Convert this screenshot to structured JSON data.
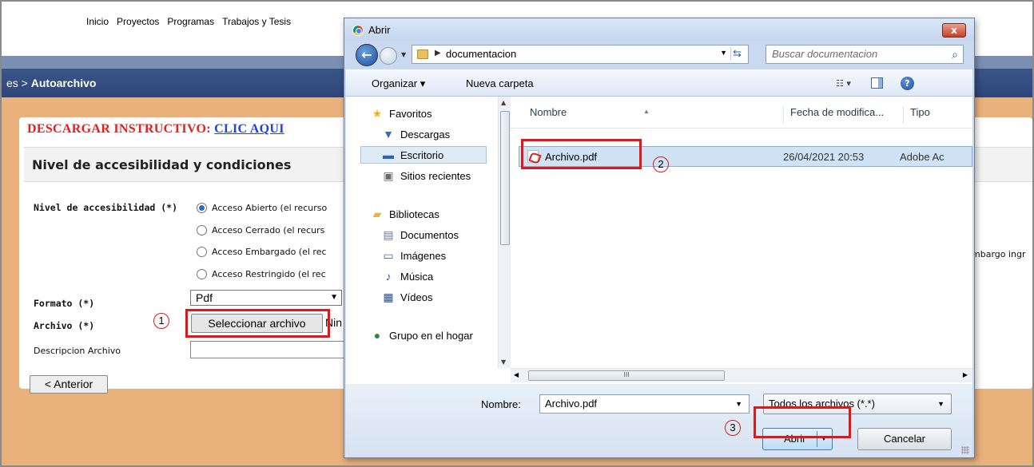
{
  "background": {
    "nav_links": [
      "Inicio",
      "Proyectos",
      "Programas",
      "Trabajos y Tesis"
    ],
    "breadcrumb_prefix": "es > ",
    "breadcrumb_current": "Autoarchivo",
    "instructivo_label": "DESCARGAR INSTRUCTIVO: ",
    "instructivo_link": "CLIC AQUI",
    "section_title": "Nivel de accesibilidad y condiciones",
    "access_label": "Nivel de accesibilidad (*)",
    "access_options": [
      "Acceso Abierto (el recurso",
      "Acceso Cerrado (el recurs",
      "Acceso Embargado (el rec",
      "Acceso Restringido (el rec"
    ],
    "access_selected_index": 0,
    "embargo_text": "mbargo ingr",
    "format_label": "Formato (*)",
    "format_value": "Pdf",
    "file_label": "Archivo (*)",
    "file_button": "Seleccionar archivo",
    "file_status": "Nin",
    "desc_label": "Descripcion Archivo",
    "prev_button": "< Anterior"
  },
  "dialog": {
    "title": "Abrir",
    "close_glyph": "x",
    "path_folder": "documentacion",
    "search_placeholder": "Buscar documentacion",
    "toolbar": {
      "organize": "Organizar ▾",
      "new_folder": "Nueva carpeta"
    },
    "nav_items": [
      {
        "label": "Favoritos",
        "icon": "star-icon"
      },
      {
        "label": "Descargas",
        "icon": "downloads-icon"
      },
      {
        "label": "Escritorio",
        "icon": "desktop-icon"
      },
      {
        "label": "Sitios recientes",
        "icon": "recent-places-icon"
      },
      {
        "label": "Bibliotecas",
        "icon": "libraries-icon"
      },
      {
        "label": "Documentos",
        "icon": "documents-icon"
      },
      {
        "label": "Imágenes",
        "icon": "images-icon"
      },
      {
        "label": "Música",
        "icon": "music-icon"
      },
      {
        "label": "Vídeos",
        "icon": "videos-icon"
      },
      {
        "label": "Grupo en el hogar",
        "icon": "homegroup-icon"
      }
    ],
    "columns": [
      "Nombre",
      "Fecha de modifica...",
      "Tipo"
    ],
    "files": [
      {
        "name": "Archivo.pdf",
        "date": "26/04/2021 20:53",
        "type": "Adobe Ac"
      }
    ],
    "scroll_thumb": "III",
    "filename_label": "Nombre:",
    "filename_value": "Archivo.pdf",
    "filter_value": "Todos los archivos (*.*)",
    "open_button": "Abrir",
    "cancel_button": "Cancelar"
  },
  "annotations": [
    "1",
    "2",
    "3"
  ],
  "colors": {
    "annotation_red": "#e01818",
    "page_orange": "#e9b27c",
    "header_blue": "#2e4679"
  }
}
